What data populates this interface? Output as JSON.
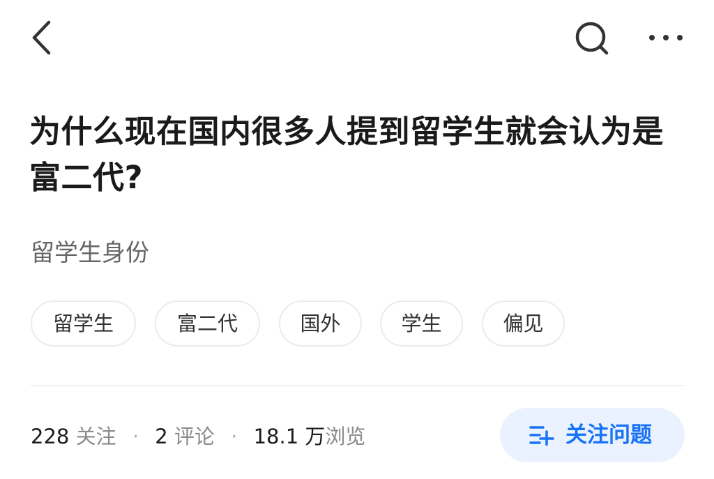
{
  "topbar": {
    "back_icon": "chevron-left-icon",
    "search_icon": "search-icon",
    "more_icon": "more-horizontal-icon"
  },
  "question": {
    "title": "为什么现在国内很多人提到留学生就会认为是富二代?",
    "detail": "留学生身份"
  },
  "tags": [
    "留学生",
    "富二代",
    "国外",
    "学生",
    "偏见"
  ],
  "stats": {
    "followers": "228",
    "followers_label": "关注",
    "comments": "2",
    "comments_label": "评论",
    "views": "18.1 万",
    "views_label": "浏览",
    "separator": "·"
  },
  "follow_button": {
    "label": "关注问题",
    "icon": "add-list-icon",
    "color": "#1772f6",
    "background": "#ebf2ff"
  }
}
